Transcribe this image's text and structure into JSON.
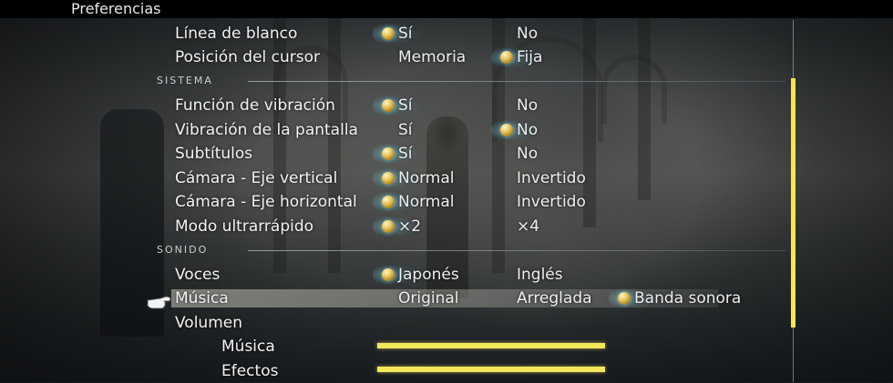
{
  "header": {
    "title": "Preferencias"
  },
  "sections": {
    "sistema": "SISTEMA",
    "sonido": "SONIDO"
  },
  "settings": {
    "linea_blanco": {
      "label": "Línea de blanco",
      "opt1": "Sí",
      "opt2": "No",
      "selected": 1
    },
    "posicion_cursor": {
      "label": "Posición del cursor",
      "opt1": "Memoria",
      "opt2": "Fija",
      "selected": 2
    },
    "vibracion": {
      "label": "Función de vibración",
      "opt1": "Sí",
      "opt2": "No",
      "selected": 1
    },
    "vibracion_pantalla": {
      "label": "Vibración de la pantalla",
      "opt1": "Sí",
      "opt2": "No",
      "selected": 2
    },
    "subtitulos": {
      "label": "Subtítulos",
      "opt1": "Sí",
      "opt2": "No",
      "selected": 1
    },
    "camara_vertical": {
      "label": "Cámara - Eje vertical",
      "opt1": "Normal",
      "opt2": "Invertido",
      "selected": 1
    },
    "camara_horizontal": {
      "label": "Cámara - Eje horizontal",
      "opt1": "Normal",
      "opt2": "Invertido",
      "selected": 1
    },
    "ultrarrapido": {
      "label": "Modo ultrarrápido",
      "opt1": "×2",
      "opt2": "×4",
      "selected": 1
    },
    "voces": {
      "label": "Voces",
      "opt1": "Japonés",
      "opt2": "Inglés",
      "selected": 1
    },
    "musica": {
      "label": "Música",
      "opt1": "Original",
      "opt2": "Arreglada",
      "opt3": "Banda sonora",
      "selected": 3
    },
    "volumen": {
      "label": "Volumen"
    },
    "volumen_musica": {
      "label": "Música",
      "level": 1.0
    },
    "volumen_efectos": {
      "label": "Efectos",
      "level": 1.0
    }
  },
  "icons": {
    "selection": "orb-icon",
    "cursor": "pointing-hand-icon"
  },
  "colors": {
    "accent": "#f3e85a",
    "orb": "#e6c45a"
  },
  "scrollbar": {
    "position_fraction": 0.16
  }
}
